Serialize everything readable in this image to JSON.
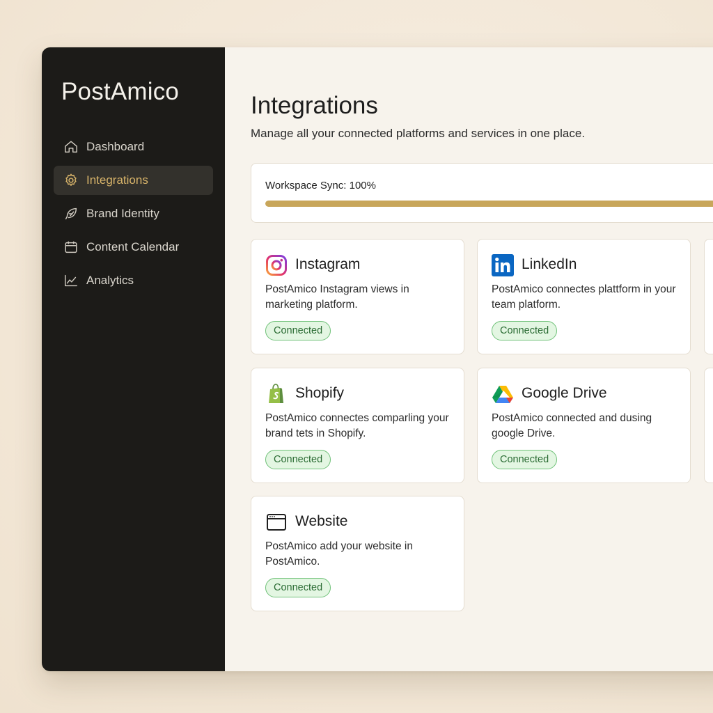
{
  "app": {
    "brand": "PostAmico"
  },
  "sidebar": {
    "items": [
      {
        "label": "Dashboard",
        "icon": "home-icon",
        "active": false
      },
      {
        "label": "Integrations",
        "icon": "gear-icon",
        "active": true
      },
      {
        "label": "Brand Identity",
        "icon": "feather-icon",
        "active": false
      },
      {
        "label": "Content Calendar",
        "icon": "calendar-icon",
        "active": false
      },
      {
        "label": "Analytics",
        "icon": "chart-line-icon",
        "active": false
      }
    ]
  },
  "header": {
    "title": "Integrations",
    "subtitle": "Manage all your connected platforms and services in one place."
  },
  "sync": {
    "label": "Workspace Sync: 100%",
    "progress": 1.0
  },
  "integrations": [
    {
      "name": "Instagram",
      "icon": "instagram-icon",
      "description": "PostAmico Instagram views in marketing platform.",
      "status": "Connected"
    },
    {
      "name": "LinkedIn",
      "icon": "linkedin-icon",
      "description": "PostAmico connectes plattform in your team platform.",
      "status": "Connected"
    },
    {
      "name": "Shopify",
      "icon": "shopify-icon",
      "description": "PostAmico connectes comparling your brand tets in Shopify.",
      "status": "Connected"
    },
    {
      "name": "Google Drive",
      "icon": "google-drive-icon",
      "description": "PostAmico connected and dusing google Drive.",
      "status": "Connected"
    },
    {
      "name": "Website",
      "icon": "browser-window-icon",
      "description": "PostAmico add your website in PostAmico.",
      "status": "Connected"
    }
  ],
  "colors": {
    "sidebar_bg": "#1c1b18",
    "accent": "#d8b46a",
    "sync_fill": "#c8a65a",
    "badge_bg": "#e3f6e2",
    "badge_border": "#6fc178"
  }
}
